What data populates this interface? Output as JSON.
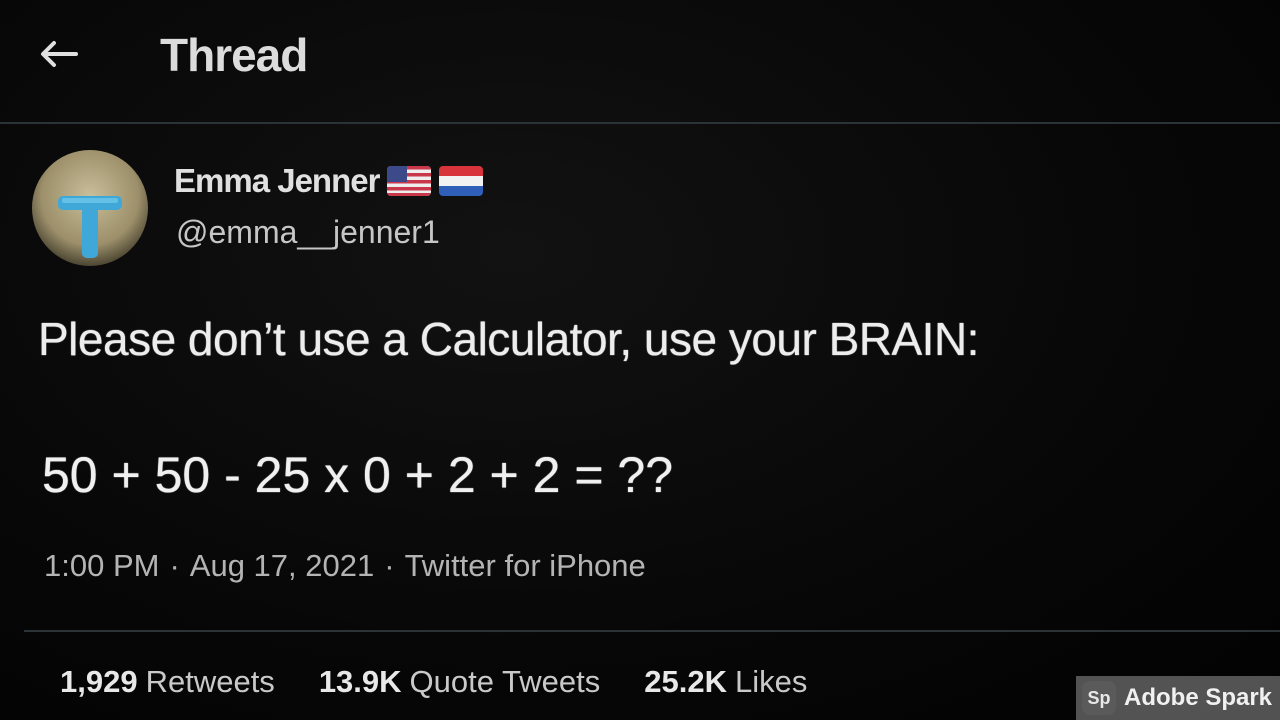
{
  "header": {
    "title": "Thread",
    "back_icon": "arrow-left-icon"
  },
  "tweet": {
    "author": {
      "display_name": "Emma Jenner",
      "handle": "@emma__jenner1",
      "flags": [
        "us-flag-icon",
        "netherlands-flag-icon"
      ]
    },
    "text": "Please don’t use a Calculator, use your BRAIN:",
    "equation": "50 + 50 - 25 x 0 + 2 + 2 = ??",
    "time": "1:00 PM",
    "date": "Aug 17, 2021",
    "source": "Twitter for iPhone",
    "separator": "·"
  },
  "stats": {
    "retweets_count": "1,929",
    "retweets_label": "Retweets",
    "quotes_count": "13.9K",
    "quotes_label": "Quote Tweets",
    "likes_count": "25.2K",
    "likes_label": "Likes"
  },
  "watermark": {
    "logo": "Sp",
    "text": "Adobe Spark"
  },
  "colors": {
    "background": "#050505",
    "text": "#e6e6e6",
    "divider": "#2c3336"
  }
}
